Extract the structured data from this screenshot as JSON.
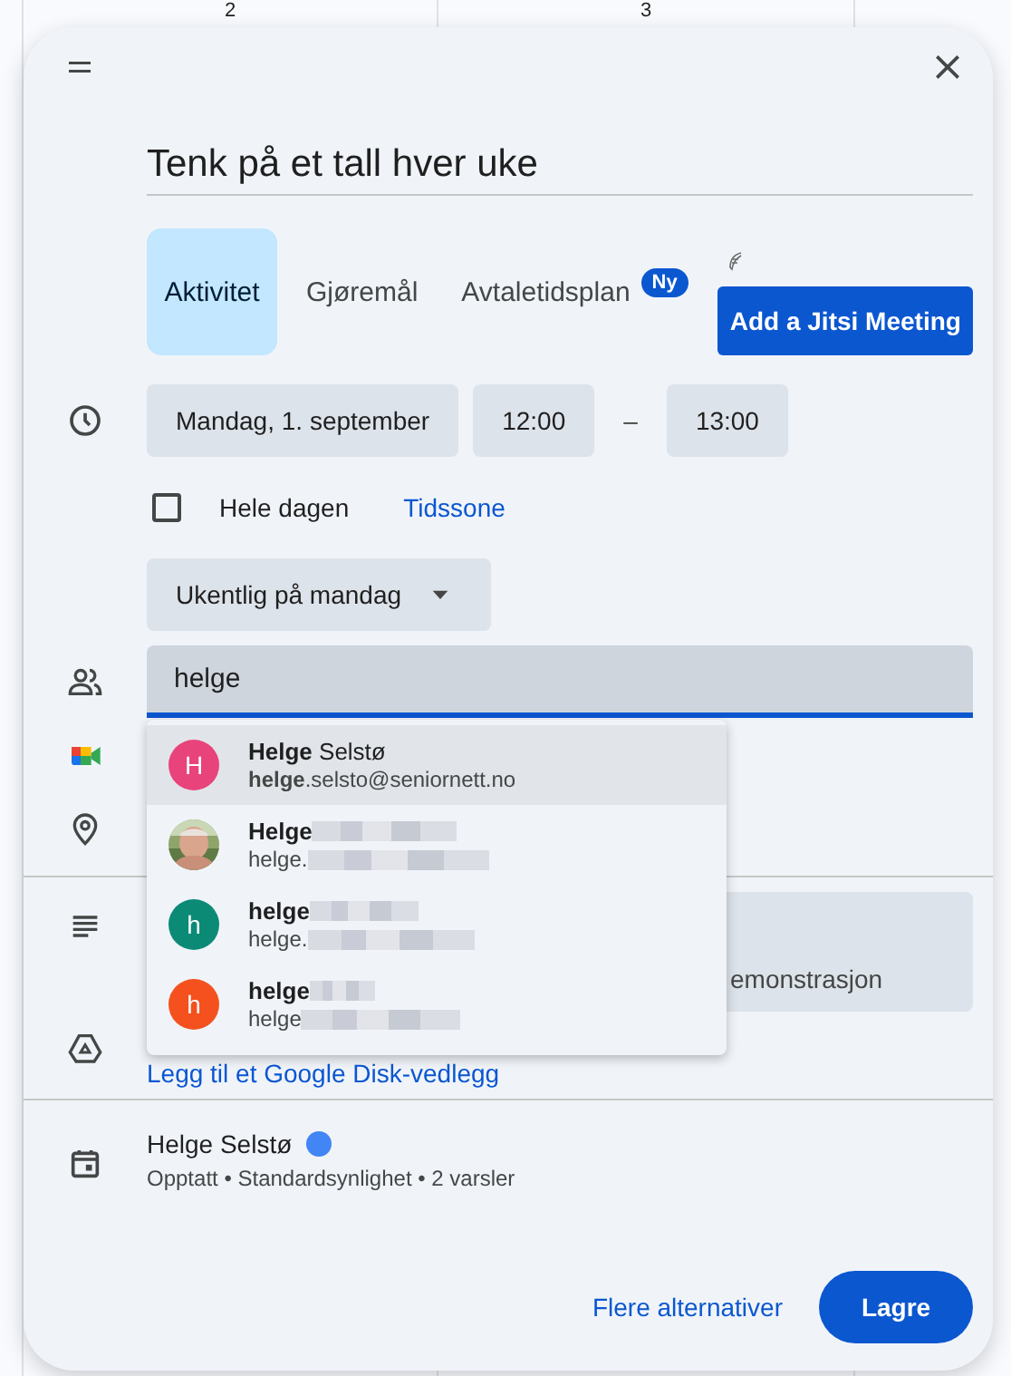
{
  "calendar": {
    "day_numbers": [
      "2",
      "3"
    ]
  },
  "dialog": {
    "title": "Tenk på et tall hver uke",
    "event_types": [
      {
        "label": "Aktivitet",
        "selected": true
      },
      {
        "label": "Gjøremål",
        "selected": false
      },
      {
        "label": "Avtaletidsplan",
        "selected": false,
        "badge": "Ny"
      }
    ],
    "jitsi_button": "Add a Jitsi Meeting",
    "date": "Mandag, 1. september",
    "start_time": "12:00",
    "time_separator": "–",
    "end_time": "13:00",
    "all_day": {
      "label": "Hele dagen",
      "checked": false
    },
    "timezone_link": "Tidssone",
    "recurrence": "Ukentlig på mandag",
    "guests_field": {
      "value": "helge"
    },
    "suggestions": [
      {
        "kind": "letter",
        "initial": "H",
        "color": "#e8437a",
        "name": "**Helge** Selstø",
        "email": "**helge**.selsto@seniornett.no",
        "selected": true,
        "redacted": false
      },
      {
        "name": "Helge",
        "email": "helge.",
        "selected": false,
        "redacted": true
      },
      {
        "kind": "letter",
        "initial": "h",
        "color": "#0b8a76",
        "name": "helge",
        "email": "helge.",
        "selected": false,
        "redacted": true
      },
      {
        "kind": "letter",
        "initial": "h",
        "color": "#f4511e",
        "name": "helge",
        "email": "helge",
        "selected": false,
        "redacted": true
      }
    ],
    "description": {
      "value": "emonstrasjon"
    },
    "drive_link": "Legg til et Google Disk-vedlegg",
    "calendar_owner": {
      "name": "Helge Selstø",
      "color": "#4285f4"
    },
    "details": "Opptatt • Standardsynlighet • 2 varsler",
    "more_options": "Flere alternativer",
    "save_button": "Lagre"
  }
}
